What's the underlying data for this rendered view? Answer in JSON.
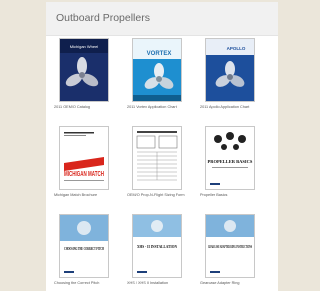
{
  "page": {
    "title": "Outboard Propellers"
  },
  "items": [
    {
      "caption": "2011 OEM/O Catalog",
      "cover_text": "Michigan Wheel"
    },
    {
      "caption": "2011 Vortex Application Chart",
      "cover_text": "VORTEX"
    },
    {
      "caption": "2011 Apollo Application Chart",
      "cover_text": "APOLLO"
    },
    {
      "caption": "Michigan Match Brochure",
      "cover_text": "MICHIGAN MATCH"
    },
    {
      "caption": "OEM/O Prop-N-Flight Sizing Form",
      "cover_text": ""
    },
    {
      "caption": "Propeller Basics",
      "cover_text": "PROPELLER BASICS"
    },
    {
      "caption": "Choosing the Correct Pitch",
      "cover_text": "CHOOSING THE CORRECT PITCH"
    },
    {
      "caption": "XHS / XHS II Installation",
      "cover_text": "XHS - II INSTALLATION"
    },
    {
      "caption": "Gearcase Adapter Ring",
      "cover_text": "GEARCASE ADAPTER RING INSTRUCTIONS"
    }
  ]
}
